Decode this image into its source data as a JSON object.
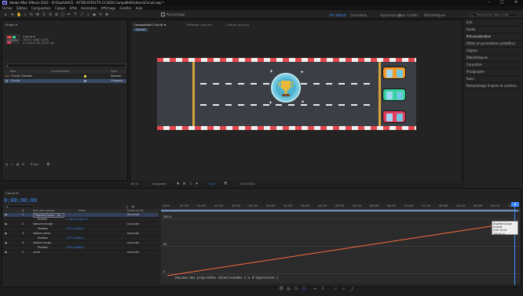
{
  "window": {
    "title": "Adobe After Effects 2022 - D:\\Tout\\VIACE - AFTER EFFECTS CC2020 Complété\\Fichiers\\Circuit.aep *",
    "minimize": "–",
    "maximize": "□",
    "close": "✕"
  },
  "menu": [
    "Fichier",
    "Édition",
    "Composition",
    "Calque",
    "Effet",
    "Animation",
    "Affichage",
    "Fenêtre",
    "Aide"
  ],
  "toolbar": {
    "snap_label": "Accrochage",
    "workspaces": [
      "Par défaut",
      "Formation",
      "Apprentissage",
      "Pour le Web",
      "Bibliothèques"
    ],
    "active_workspace": "Par défaut",
    "search_placeholder": "Rechercher dans l'aide"
  },
  "project_panel": {
    "tab": "Projet ≡",
    "selected_name": "Circuit ▾",
    "selected_info": [
      "1920 x 1080 (1,00)",
      "Δ 0;00;10;00, 29,97 ips"
    ],
    "search_placeholder": "ρ.",
    "columns": [
      "Nom",
      "Commentaire",
      "Type"
    ],
    "items": [
      {
        "name": "Circuit Calques",
        "label_color": "#e6c84a",
        "type": "Dossier"
      },
      {
        "name": "Circuit",
        "label_color": "#8e98b0",
        "type": "Compos."
      }
    ],
    "footer_bpc": "8 bpc"
  },
  "comp_panel": {
    "tabs": [
      "Composition Circuit ≡",
      "Métrage (aucun)",
      "Calque (aucun)"
    ],
    "active_tab": "Composition Circuit ≡",
    "breadcrumb": "Circuit",
    "footer": {
      "zoom": "65 %",
      "resolution": "(Intégrale)",
      "exposure": "+0,0",
      "timecode": "0;00;00;00"
    }
  },
  "right_panels": [
    "Info",
    "Audio",
    "Prévisualisation",
    "Effets et paramètres prédéfinis",
    "Aligner",
    "Bibliothèques",
    "Caractère",
    "Paragraphe",
    "Suivi",
    "Remplissage d'après le contenu"
  ],
  "timeline": {
    "tab": "Circuit ≡",
    "timecode": "0;00;00;00",
    "search_placeholder": "ρ.",
    "columns": [
      "#",
      "Nom des calques",
      "Mode",
      "Parent et lien"
    ],
    "layers": [
      {
        "num": "1",
        "name": "Trophée/Coupe - Sp...",
        "mode": "Aucun(e)",
        "value": ""
      },
      {
        "num": "",
        "name": "Échelle",
        "mode": "",
        "value": "∞ 100,0,100,0 %"
      },
      {
        "num": "2",
        "name": "Voiture orange",
        "mode": "Aucun(e)",
        "value": ""
      },
      {
        "num": "",
        "name": "Position",
        "mode": "",
        "value": "1771,0,254,0"
      },
      {
        "num": "3",
        "name": "Voiture verte",
        "mode": "Aucun(e)",
        "value": ""
      },
      {
        "num": "",
        "name": "Position",
        "mode": "",
        "value": "1771,0,542,0"
      },
      {
        "num": "4",
        "name": "Voiture rouge",
        "mode": "Aucun(e)",
        "value": ""
      },
      {
        "num": "",
        "name": "Position",
        "mode": "",
        "value": "1771,0,884,0"
      },
      {
        "num": "5",
        "name": "route",
        "mode": "Aucun(e)",
        "value": ""
      }
    ],
    "ruler_ticks": [
      "0;00f",
      "00:15f",
      "01:00f",
      "01:15f",
      "02:00f",
      "02:15f",
      "03:00f",
      "03:15f",
      "04:00f",
      "04:15f",
      "05:00f",
      "05:15f",
      "06:00f",
      "06:15f",
      "07:00f",
      "07:15f",
      "08:00f",
      "08:15f",
      "09:00f",
      "09:15f",
      "10:0"
    ],
    "graph_labels": [
      "100 %",
      "50",
      "0"
    ],
    "tooltip": [
      "Trophée/Coupe - Échelle",
      "0:00:10:00",
      "100,00 %"
    ],
    "expression_text": "(Aucune des propriétés sélectionnées n'a d'expression.)"
  },
  "colors": {
    "accent": "#3d8bff",
    "curve": "#ff6b3d",
    "car_orange": "#f39a2b",
    "car_green": "#39d3a1",
    "car_red": "#e23d5b",
    "trophy": "#e8b83a"
  }
}
